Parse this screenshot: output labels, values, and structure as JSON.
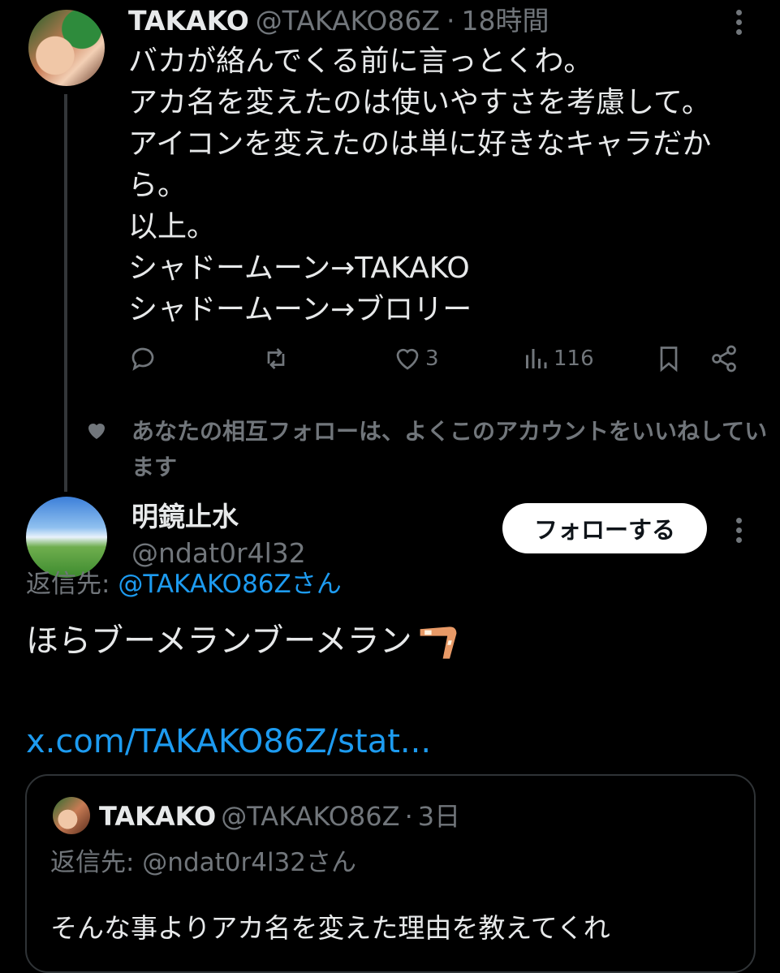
{
  "tweet1": {
    "display_name": "TAKAKO",
    "handle": "@TAKAKO86Z",
    "separator": "·",
    "time": "18時間",
    "text": "バカが絡んでくる前に言っとくわ。\nアカ名を変えたのは使いやすさを考慮して。\nアイコンを変えたのは単に好きなキャラだか\nら。\n以上。\nシャドームーン→TAKAKO\nシャドームーン→ブロリー",
    "likes": "3",
    "views": "116"
  },
  "social_context": "あなたの相互フォローは、よくこのアカウントをいいねしています",
  "tweet2": {
    "display_name": "明鏡止水",
    "handle": "@ndat0r4l32",
    "follow_label": "フォローする",
    "reply_prefix": "返信先:",
    "reply_target": "@TAKAKO86Zさん",
    "text": "ほらブーメランブーメラン",
    "link": "x.com/TAKAKO86Z/stat..."
  },
  "quote": {
    "display_name": "TAKAKO",
    "handle": "@TAKAKO86Z",
    "separator": "·",
    "time": "3日",
    "reply_line": "返信先: @ndat0r4l32さん",
    "text": "そんな事よりアカ名を変えた理由を教えてくれ"
  },
  "colors": {
    "background": "#000000",
    "text": "#e7e9ea",
    "muted": "#71767b",
    "link": "#1d9bf0",
    "border": "#2f3336"
  },
  "icons": [
    "reply-icon",
    "retweet-icon",
    "like-icon",
    "views-icon",
    "bookmark-icon",
    "share-icon",
    "more-icon",
    "heart-small-icon",
    "boomerang-emoji"
  ]
}
